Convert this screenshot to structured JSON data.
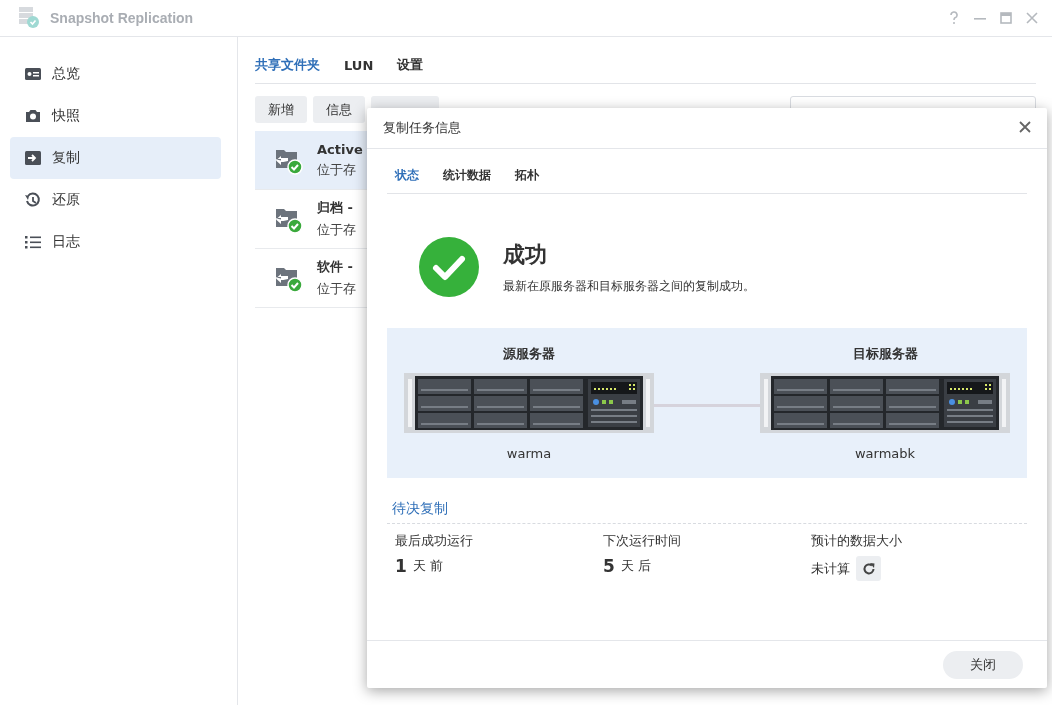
{
  "window": {
    "title": "Snapshot Replication"
  },
  "sidebar": {
    "items": [
      {
        "label": "总览",
        "selected": false
      },
      {
        "label": "快照",
        "selected": false
      },
      {
        "label": "复制",
        "selected": true
      },
      {
        "label": "还原",
        "selected": false
      },
      {
        "label": "日志",
        "selected": false
      }
    ]
  },
  "main": {
    "tabs": [
      {
        "label": "共享文件夹",
        "selected": true
      },
      {
        "label": "LUN",
        "selected": false
      },
      {
        "label": "设置",
        "selected": false
      }
    ],
    "toolbar": {
      "buttons": [
        "新增",
        "信息"
      ]
    },
    "rows": [
      {
        "title": "Active",
        "subtitle": "位于存",
        "selected": true
      },
      {
        "title": "归档 - ",
        "subtitle": "位于存",
        "selected": false
      },
      {
        "title": "软件 - ",
        "subtitle": "位于存",
        "selected": false
      }
    ]
  },
  "dialog": {
    "title": "复制任务信息",
    "tabs": [
      {
        "label": "状态",
        "selected": true
      },
      {
        "label": "统计数据",
        "selected": false
      },
      {
        "label": "拓朴",
        "selected": false
      }
    ],
    "status": {
      "title": "成功",
      "message": "最新在原服务器和目标服务器之间的复制成功。"
    },
    "diagram": {
      "source": {
        "label": "源服务器",
        "name": "warma"
      },
      "target": {
        "label": "目标服务器",
        "name": "warmabk"
      }
    },
    "section_title": "待决复制",
    "stats": [
      {
        "label": "最后成功运行",
        "number": "1",
        "unit": "天 前"
      },
      {
        "label": "下次运行时间",
        "number": "5",
        "unit": "天 后"
      }
    ],
    "size": {
      "label": "预计的数据大小",
      "value": "未计算"
    },
    "close_button": "关闭"
  }
}
